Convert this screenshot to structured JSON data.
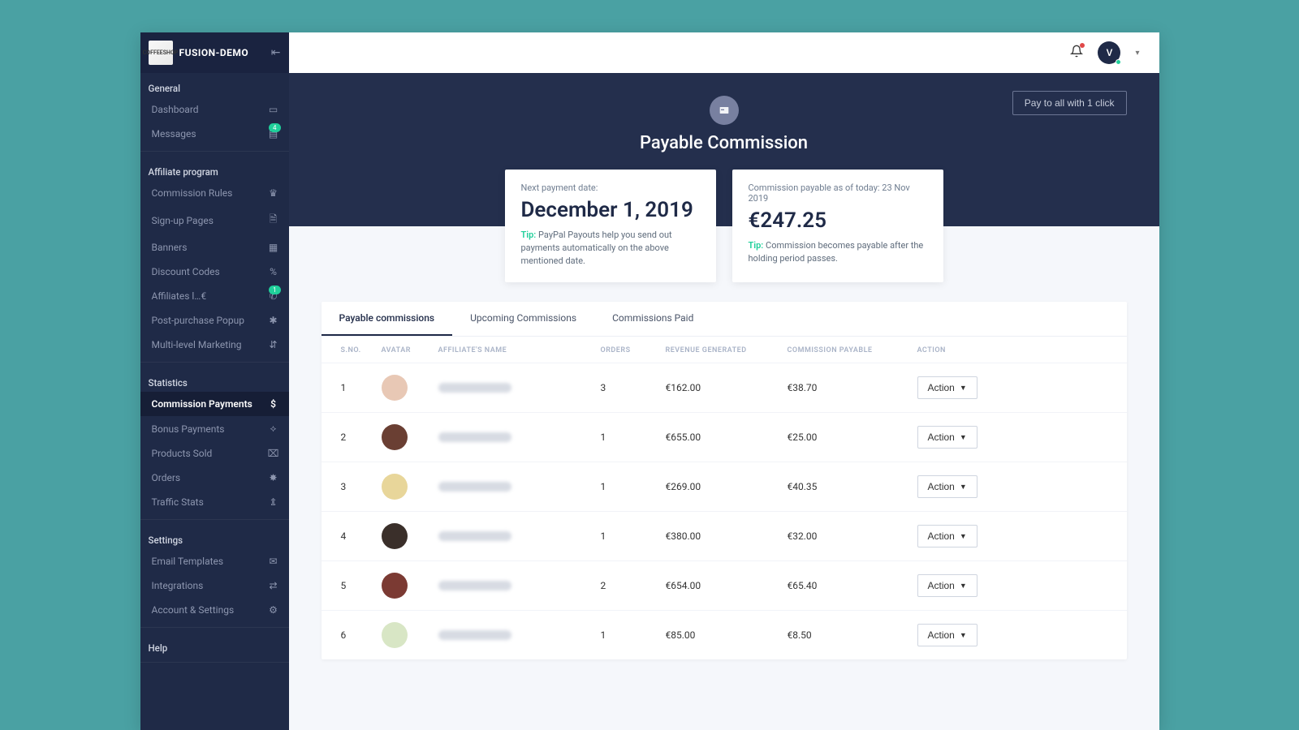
{
  "brand": "FUSION-DEMO",
  "logo_text": "COFFEESHOP",
  "topbar": {
    "avatar_letter": "V"
  },
  "sidebar": {
    "sections": [
      {
        "title": "General",
        "items": [
          {
            "label": "Dashboard",
            "icon": "▭",
            "badge": null
          },
          {
            "label": "Messages",
            "icon": "▤",
            "badge": "4"
          }
        ]
      },
      {
        "title": "Affiliate program",
        "items": [
          {
            "label": "Commission Rules",
            "icon": "♛",
            "badge": null
          },
          {
            "label": "Sign-up Pages",
            "icon": "🗎",
            "badge": null
          },
          {
            "label": "Banners",
            "icon": "▦",
            "badge": null
          },
          {
            "label": "Discount Codes",
            "icon": "%",
            "badge": null
          },
          {
            "label": "Affiliates l…€",
            "icon": "✆",
            "badge": "1"
          },
          {
            "label": "Post-purchase Popup",
            "icon": "✱",
            "badge": null
          },
          {
            "label": "Multi-level Marketing",
            "icon": "⇵",
            "badge": null
          }
        ]
      },
      {
        "title": "Statistics",
        "items": [
          {
            "label": "Commission Payments",
            "icon": "$",
            "badge": null,
            "active": true
          },
          {
            "label": "Bonus Payments",
            "icon": "⟡",
            "badge": null
          },
          {
            "label": "Products Sold",
            "icon": "⌧",
            "badge": null
          },
          {
            "label": "Orders",
            "icon": "✸",
            "badge": null
          },
          {
            "label": "Traffic Stats",
            "icon": "⇭",
            "badge": null
          }
        ]
      },
      {
        "title": "Settings",
        "items": [
          {
            "label": "Email Templates",
            "icon": "✉",
            "badge": null
          },
          {
            "label": "Integrations",
            "icon": "⇄",
            "badge": null
          },
          {
            "label": "Account & Settings",
            "icon": "⚙",
            "badge": null
          }
        ]
      },
      {
        "title": "Help",
        "items": []
      }
    ]
  },
  "hero": {
    "title": "Payable Commission",
    "pay_all_button": "Pay to all with 1 click"
  },
  "cards": [
    {
      "label": "Next payment date:",
      "value": "December 1, 2019",
      "tip_prefix": "Tip:",
      "tip_text": "PayPal Payouts help you send out payments automatically on the above mentioned date."
    },
    {
      "label": "Commission payable as of today: 23 Nov 2019",
      "value": "€247.25",
      "tip_prefix": "Tip:",
      "tip_text": "Commission becomes payable after the holding period passes."
    }
  ],
  "tabs": [
    {
      "label": "Payable commissions",
      "active": true
    },
    {
      "label": "Upcoming Commissions",
      "active": false
    },
    {
      "label": "Commissions Paid",
      "active": false
    }
  ],
  "columns": {
    "sno": "S.NO.",
    "avatar": "AVATAR",
    "name": "AFFILIATE'S NAME",
    "orders": "ORDERS",
    "revenue": "REVENUE GENERATED",
    "commission": "COMMISSION PAYABLE",
    "action": "ACTION"
  },
  "action_label": "Action",
  "rows": [
    {
      "sno": "1",
      "orders": "3",
      "revenue": "€162.00",
      "commission": "€38.70",
      "av": "#e8c8b5"
    },
    {
      "sno": "2",
      "orders": "1",
      "revenue": "€655.00",
      "commission": "€25.00",
      "av": "#6a3f33"
    },
    {
      "sno": "3",
      "orders": "1",
      "revenue": "€269.00",
      "commission": "€40.35",
      "av": "#e8d69a"
    },
    {
      "sno": "4",
      "orders": "1",
      "revenue": "€380.00",
      "commission": "€32.00",
      "av": "#3a2f2a"
    },
    {
      "sno": "5",
      "orders": "2",
      "revenue": "€654.00",
      "commission": "€65.40",
      "av": "#7b3a33"
    },
    {
      "sno": "6",
      "orders": "1",
      "revenue": "€85.00",
      "commission": "€8.50",
      "av": "#d8e6c5"
    }
  ]
}
